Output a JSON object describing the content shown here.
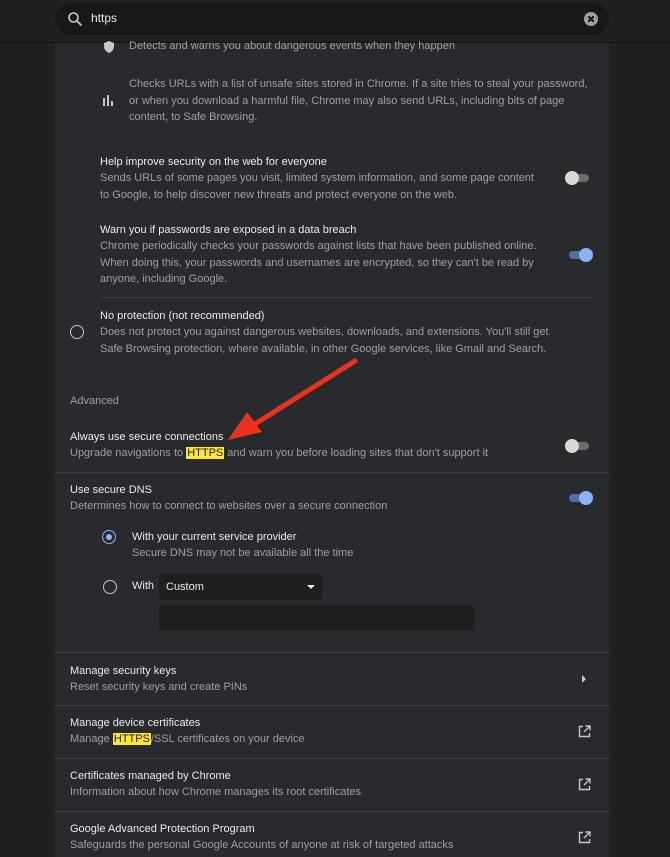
{
  "search": {
    "query": "https"
  },
  "safe_browsing": {
    "events_desc": "Detects and warns you about dangerous events when they happen",
    "urls_desc": "Checks URLs with a list of unsafe sites stored in Chrome. If a site tries to steal your password, or when you download a harmful file, Chrome may also send URLs, including bits of page content, to Safe Browsing.",
    "help_improve": {
      "title": "Help improve security on the web for everyone",
      "desc": "Sends URLs of some pages you visit, limited system information, and some page content to Google, to help discover new threats and protect everyone on the web.",
      "enabled": false
    },
    "password_warn": {
      "title": "Warn you if passwords are exposed in a data breach",
      "desc": "Chrome periodically checks your passwords against lists that have been published online. When doing this, your passwords and usernames are encrypted, so they can't be read by anyone, including Google.",
      "enabled": true
    },
    "no_protection": {
      "title": "No protection (not recommended)",
      "desc": "Does not protect you against dangerous websites, downloads, and extensions. You'll still get Safe Browsing protection, where available, in other Google services, like Gmail and Search."
    }
  },
  "advanced": {
    "label": "Advanced",
    "https_only": {
      "title": "Always use secure connections",
      "desc_before": "Upgrade navigations to ",
      "desc_highlight": "HTTPS",
      "desc_after": " and warn you before loading sites that don't support it",
      "enabled": false
    },
    "secure_dns": {
      "title": "Use secure DNS",
      "desc": "Determines how to connect to websites over a secure connection",
      "enabled": true,
      "option_current": {
        "title": "With your current service provider",
        "desc": "Secure DNS may not be available all the time",
        "selected": true
      },
      "option_with": {
        "label": "With",
        "select_value": "Custom",
        "selected": false
      }
    }
  },
  "rows": [
    {
      "title": "Manage security keys",
      "desc": "Reset security keys and create PINs",
      "icon": "chevron-right-icon"
    },
    {
      "title": "Manage device certificates",
      "desc_before": "Manage ",
      "desc_highlight": "HTTPS",
      "desc_after": "/SSL certificates on your device",
      "icon": "external-link-icon"
    },
    {
      "title": "Certificates managed by Chrome",
      "desc": "Information about how Chrome manages its root certificates",
      "icon": "external-link-icon"
    },
    {
      "title": "Google Advanced Protection Program",
      "desc": "Safeguards the personal Google Accounts of anyone at risk of targeted attacks",
      "icon": "external-link-icon"
    }
  ],
  "colors": {
    "background": "#1f2022",
    "card": "#292a2d",
    "accent": "#8ab4f8",
    "highlight": "#ffe534",
    "annotation_arrow": "#e8321e"
  }
}
